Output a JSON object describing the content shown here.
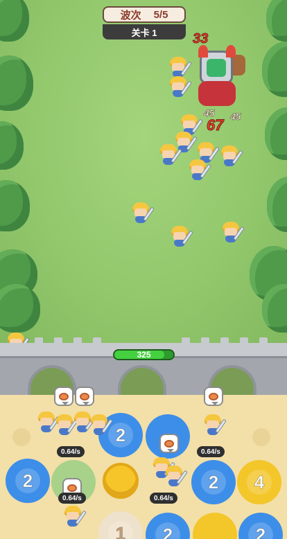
{
  "hud": {
    "wave_label": "波次",
    "wave_value": "5/5",
    "level_label": "关卡 1"
  },
  "boss": {
    "damage": "33"
  },
  "damage_popups": {
    "big": "67",
    "small_1": "45",
    "small_2": "45"
  },
  "wall": {
    "hp": "325",
    "hp_fraction": 0.85
  },
  "board": {
    "rates": [
      "0.64/s",
      "0.64/s",
      "0.64/s",
      "0.64/s"
    ],
    "gears": [
      {
        "id": "g1",
        "label": "2",
        "color": "blue"
      },
      {
        "id": "g2",
        "label": "2",
        "color": "blue"
      },
      {
        "id": "g3",
        "label": "2",
        "color": "blue"
      },
      {
        "id": "g4",
        "label": "4",
        "color": "yellow"
      },
      {
        "id": "g5",
        "label": "1",
        "color": "cream"
      },
      {
        "id": "g6",
        "label": "2",
        "color": "blue"
      },
      {
        "id": "g7",
        "label": "2",
        "color": "blue"
      }
    ]
  },
  "colors": {
    "grass": "#93c86d",
    "wall": "#a3a7ad",
    "board": "#f3dfa8",
    "hp_green": "#45d13f",
    "gear_blue": "#3d8ee8",
    "gear_yellow": "#f3c62a"
  }
}
